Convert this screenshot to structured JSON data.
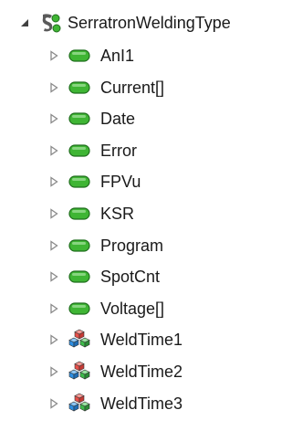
{
  "tree": {
    "root": {
      "label": "SerratronWeldingType",
      "icon": "structure-icon",
      "expanded": true
    },
    "children": [
      {
        "label": "AnI1",
        "icon": "variable-icon"
      },
      {
        "label": "Current[]",
        "icon": "variable-icon"
      },
      {
        "label": "Date",
        "icon": "variable-icon"
      },
      {
        "label": "Error",
        "icon": "variable-icon"
      },
      {
        "label": "FPVu",
        "icon": "variable-icon"
      },
      {
        "label": "KSR",
        "icon": "variable-icon"
      },
      {
        "label": "Program",
        "icon": "variable-icon"
      },
      {
        "label": "SpotCnt",
        "icon": "variable-icon"
      },
      {
        "label": "Voltage[]",
        "icon": "variable-icon"
      },
      {
        "label": "WeldTime1",
        "icon": "object-type-icon"
      },
      {
        "label": "WeldTime2",
        "icon": "object-type-icon"
      },
      {
        "label": "WeldTime3",
        "icon": "object-type-icon"
      }
    ]
  },
  "colors": {
    "variable_fill": "#3fb534",
    "variable_edge": "#1f6e1c",
    "cube_red": "#e8504a",
    "cube_blue": "#2d8fe3",
    "cube_green": "#3dbb4a",
    "text": "#1a1a1a",
    "arrow": "#8a8a8a"
  }
}
